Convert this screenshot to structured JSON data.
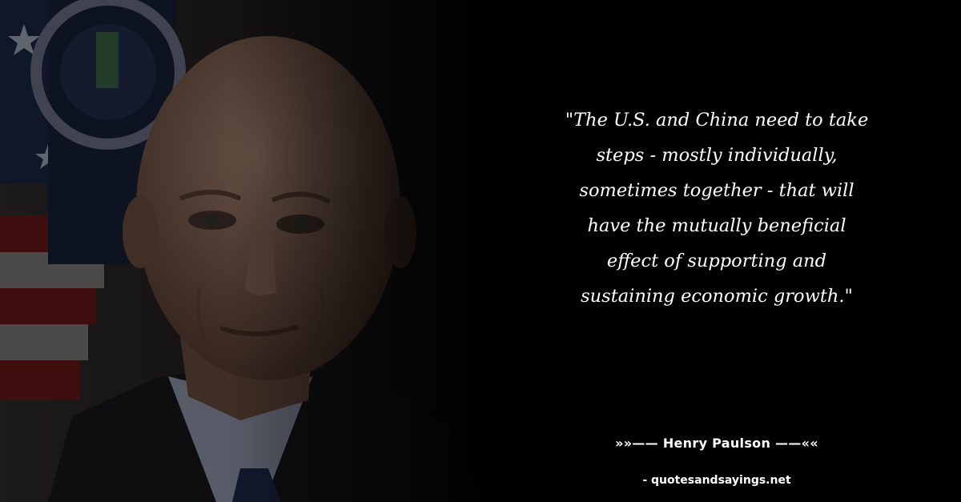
{
  "quote": {
    "lines": [
      "\"The U.S. and China need to take",
      "steps - mostly individually,",
      "sometimes together - that will",
      "have the mutually beneficial",
      "effect of supporting and",
      "sustaining economic growth.\""
    ]
  },
  "attribution": {
    "prefix": "»»—— ",
    "author": "Henry Paulson",
    "suffix": " ——««"
  },
  "source": {
    "text": "- quotesandsayings.net"
  },
  "photo": {
    "subject": "portrait-photo",
    "background_flag": "us-flag",
    "background_seal": "department-seal"
  },
  "colors": {
    "background": "#000000",
    "text": "#ffffff",
    "flag_red": "#5a1414",
    "flag_blue": "#16213a",
    "skin": "#7b5d4c",
    "suit": "#141418",
    "shirt": "#7d8394",
    "tie": "#1b2340"
  }
}
